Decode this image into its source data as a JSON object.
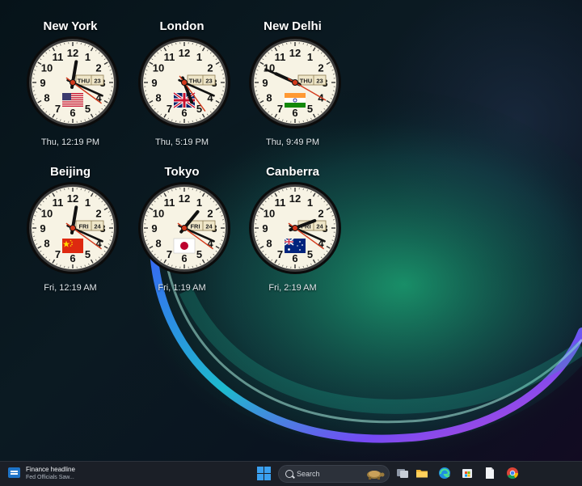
{
  "clocks": [
    {
      "city": "New York",
      "time": "Thu, 12:19 PM",
      "day": "THU",
      "date": "23",
      "hour": 12,
      "minute": 19,
      "second": 21,
      "flag": "us-flag-icon"
    },
    {
      "city": "London",
      "time": "Thu, 5:19 PM",
      "day": "THU",
      "date": "23",
      "hour": 5,
      "minute": 19,
      "second": 24,
      "flag": "uk-flag-icon"
    },
    {
      "city": "New Delhi",
      "time": "Thu, 9:49 PM",
      "day": "THU",
      "date": "23",
      "hour": 9,
      "minute": 49,
      "second": 20,
      "flag": "india-flag-icon"
    },
    {
      "city": "Beijing",
      "time": "Fri, 12:19 AM",
      "day": "FRI",
      "date": "24",
      "hour": 12,
      "minute": 19,
      "second": 21,
      "flag": "china-flag-icon"
    },
    {
      "city": "Tokyo",
      "time": "Fri, 1:19 AM",
      "day": "FRI",
      "date": "24",
      "hour": 1,
      "minute": 19,
      "second": 21,
      "flag": "japan-flag-icon"
    },
    {
      "city": "Canberra",
      "time": "Fri, 2:19 AM",
      "day": "FRI",
      "date": "24",
      "hour": 2,
      "minute": 19,
      "second": 21,
      "flag": "australia-flag-icon"
    }
  ],
  "dial_numbers": [
    "12",
    "1",
    "2",
    "3",
    "4",
    "5",
    "6",
    "7",
    "8",
    "9",
    "10",
    "11"
  ],
  "taskbar": {
    "widget_title": "Finance headline",
    "widget_subtitle": "Fed Officials Saw...",
    "search_placeholder": "Search",
    "icons": [
      "windows-start-icon",
      "task-view-icon",
      "file-explorer-icon",
      "edge-browser-icon",
      "store-icon",
      "document-icon",
      "chrome-icon"
    ]
  },
  "colors": {
    "dial_face": "#f7f3e4",
    "hand": "#111111",
    "second_hand": "#d33a1c",
    "accent_blue": "#3aa0f0"
  }
}
